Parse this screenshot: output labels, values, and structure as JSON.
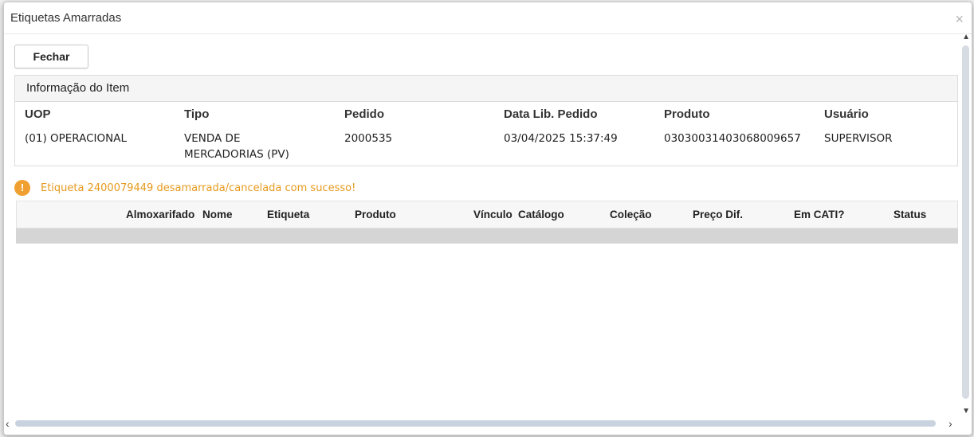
{
  "dialog": {
    "title": "Etiquetas Amarradas",
    "close_glyph": "×",
    "close_button_label": "Fechar"
  },
  "info_panel": {
    "heading": "Informação do Item",
    "fields": [
      {
        "label": "UOP",
        "value": "(01) OPERACIONAL"
      },
      {
        "label": "Tipo",
        "value": "VENDA DE MERCADORIAS (PV)"
      },
      {
        "label": "Pedido",
        "value": "2000535"
      },
      {
        "label": "Data Lib. Pedido",
        "value": "03/04/2025 15:37:49"
      },
      {
        "label": "Produto",
        "value": "03030031403068009657"
      },
      {
        "label": "Usuário",
        "value": "SUPERVISOR"
      }
    ]
  },
  "alert": {
    "icon": "!",
    "message": "Etiqueta 2400079449 desamarrada/cancelada com sucesso!",
    "color": "#e69a1e"
  },
  "grid": {
    "columns": [
      "Almoxarifado",
      "Nome",
      "Etiqueta",
      "Produto",
      "Vínculo",
      "Catálogo",
      "Coleção",
      "Preço Dif.",
      "Em CATI?",
      "Status"
    ],
    "rows": []
  },
  "scroll": {
    "left": "‹",
    "right": "›",
    "up": "▲",
    "down": "▼"
  }
}
